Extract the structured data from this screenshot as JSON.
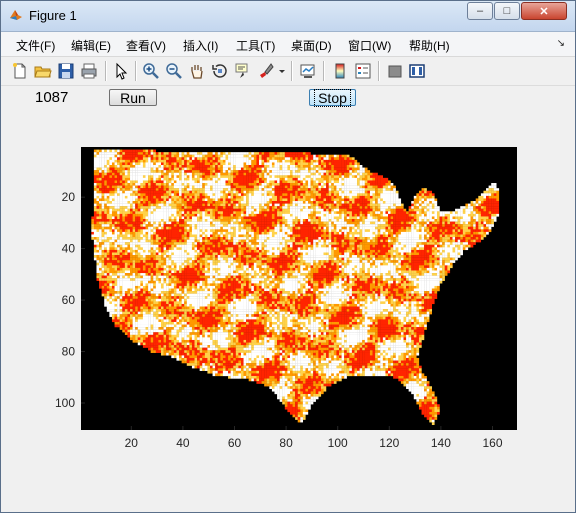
{
  "window": {
    "title": "Figure 1"
  },
  "window_controls": {
    "minimize": "–",
    "maximize": "□",
    "close": "✕"
  },
  "menu": {
    "items": [
      "文件(F)",
      "编辑(E)",
      "查看(V)",
      "插入(I)",
      "工具(T)",
      "桌面(D)",
      "窗口(W)",
      "帮助(H)"
    ],
    "overflow_arrow": "↘"
  },
  "toolbar": {
    "icons": [
      "new-figure-icon",
      "open-file-icon",
      "save-icon",
      "print-icon",
      "select-arrow-icon",
      "zoom-in-icon",
      "zoom-out-icon",
      "pan-hand-icon",
      "rotate-3d-icon",
      "data-cursor-icon",
      "brush-icon",
      "brush-dropdown-icon",
      "link-plot-icon",
      "colorbar-icon",
      "legend-icon",
      "hide-plot-tools-icon",
      "show-plot-tools-icon"
    ]
  },
  "controls": {
    "counter": "1087",
    "run_label": "Run",
    "stop_label": "Stop"
  },
  "chart_data": {
    "type": "heatmap",
    "description_colormap": [
      "black",
      "red",
      "orange",
      "yellow",
      "white"
    ],
    "x_ticks": [
      20,
      40,
      60,
      80,
      100,
      120,
      140,
      160
    ],
    "y_ticks": [
      20,
      40,
      60,
      80,
      100
    ],
    "xlim": [
      0.5,
      169.5
    ],
    "ylim": [
      0.5,
      110.5
    ],
    "colors": {
      "background": "#000000",
      "hot": "#ff2400",
      "mid": "#ff9900",
      "warm": "#ffd24a",
      "cool": "#ffffff"
    }
  }
}
